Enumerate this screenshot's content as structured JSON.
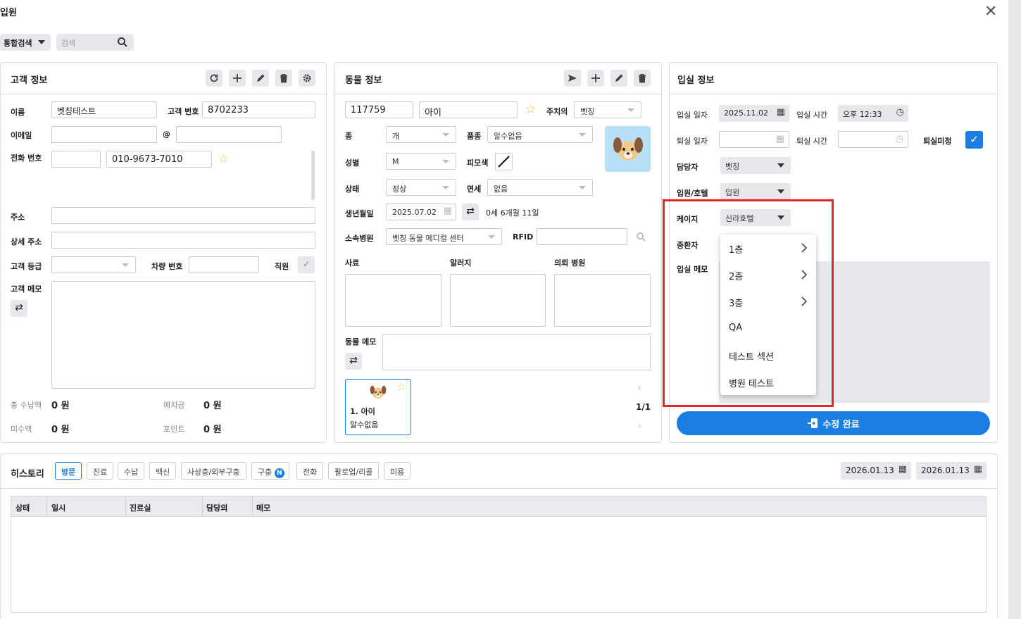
{
  "window": {
    "title": "입원"
  },
  "search": {
    "type_label": "통합검색",
    "placeholder": "검색"
  },
  "customer": {
    "title": "고객 정보",
    "name_label": "이름",
    "name_value": "벳칭테스트",
    "number_label": "고객 번호",
    "number_value": "8702233",
    "email_label": "이메일",
    "at": "@",
    "phone_label": "전화 번호",
    "phone_value": "010-9673-7010",
    "address_label": "주소",
    "detail_address_label": "상세 주소",
    "grade_label": "고객 등급",
    "car_label": "차량 번호",
    "staff_label": "직원",
    "memo_label": "고객 메모",
    "total_paid_label": "총 수납액",
    "total_paid_value": "0 원",
    "deposit_label": "예치금",
    "deposit_value": "0 원",
    "unpaid_label": "미수액",
    "unpaid_value": "0 원",
    "point_label": "포인트",
    "point_value": "0 원"
  },
  "animal": {
    "title": "동물 정보",
    "id_value": "117759",
    "name_value": "아이",
    "caution_label": "주치의",
    "caution_value": "벳칭",
    "species_label": "종",
    "species_value": "개",
    "breed_label": "품종",
    "breed_value": "알수없음",
    "sex_label": "성별",
    "sex_value": "M",
    "color_label": "피모색",
    "status_label": "상태",
    "status_value": "정상",
    "tax_label": "면세",
    "tax_value": "없음",
    "birth_label": "생년월일",
    "birth_value": "2025.07.02",
    "age_value": "0세 6개월 11일",
    "hospital_label": "소속병원",
    "hospital_value": "벳칭 동물 메디컬 센터",
    "rfid_label": "RFID",
    "feed_label": "사료",
    "allergy_label": "알러지",
    "referral_label": "의뢰 병원",
    "memo_label": "동물 메모",
    "card_name": "1. 아이",
    "card_breed": "알수없음",
    "page": "1/1"
  },
  "admission": {
    "title": "입실 정보",
    "date_label": "입실 일자",
    "date_value": "2025.11.02",
    "time_label": "입실 시간",
    "time_value": "오후 12:33",
    "out_date_label": "퇴실 일자",
    "out_time_label": "퇴실 시간",
    "out_pending_label": "퇴실미정",
    "manager_label": "담당자",
    "manager_value": "벳칭",
    "type_label": "입원/호텔",
    "type_value": "입원",
    "cage_label": "케이지",
    "cage_value": "신라호텔",
    "severity_label": "중환자",
    "memo_label": "입실 메모",
    "submit_label": "수정 완료",
    "cage_menu": [
      {
        "label": "1층",
        "submenu": true
      },
      {
        "label": "2층",
        "submenu": true
      },
      {
        "label": "3층",
        "submenu": true
      },
      {
        "label": "QA",
        "submenu": false
      },
      {
        "label": "테스트 섹션",
        "submenu": false
      },
      {
        "label": "병원 테스트",
        "submenu": false
      }
    ]
  },
  "history": {
    "title": "히스토리",
    "tabs": [
      "방문",
      "진료",
      "수납",
      "백신",
      "사상충/외부구충",
      "구충",
      "전화",
      "팔로업/리콜",
      "미용"
    ],
    "new_badge": "N",
    "date_from": "2026.01.13",
    "date_to": "2026.01.13",
    "columns": [
      "상태",
      "일시",
      "진료실",
      "담당의",
      "메모"
    ]
  },
  "colors": {
    "accent": "#1a7fe0",
    "highlight": "#e3262a"
  }
}
